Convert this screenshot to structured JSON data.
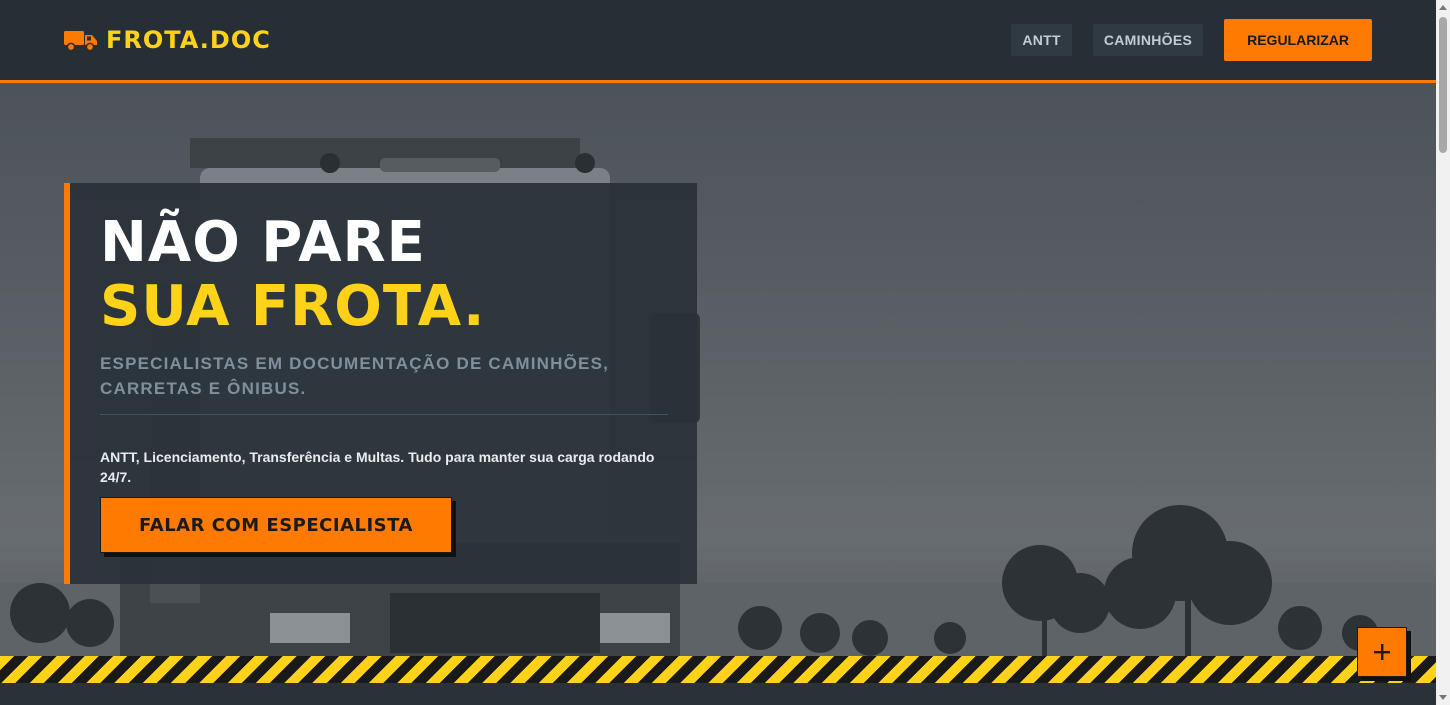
{
  "header": {
    "brand": "FROTA.DOC",
    "nav": [
      {
        "label": "ANTT"
      },
      {
        "label": "CAMINHÕES"
      }
    ],
    "cta_label": "REGULARIZAR"
  },
  "hero": {
    "title_line1": "NÃO PARE",
    "title_line2": "SUA FROTA.",
    "subtitle": "ESPECIALISTAS EM DOCUMENTAÇÃO DE CAMINHÕES, CARRETAS E ÔNIBUS.",
    "description": "ANTT, Licenciamento, Transferência e Multas. Tudo para manter sua carga rodando 24/7.",
    "cta_label": "FALAR COM ESPECIALISTA"
  },
  "fab": {
    "icon": "plus-icon"
  },
  "colors": {
    "accent": "#ff7a00",
    "brand_yellow": "#ffd21a",
    "dark": "#262f36"
  },
  "icons": {
    "logo": "truck-icon"
  }
}
